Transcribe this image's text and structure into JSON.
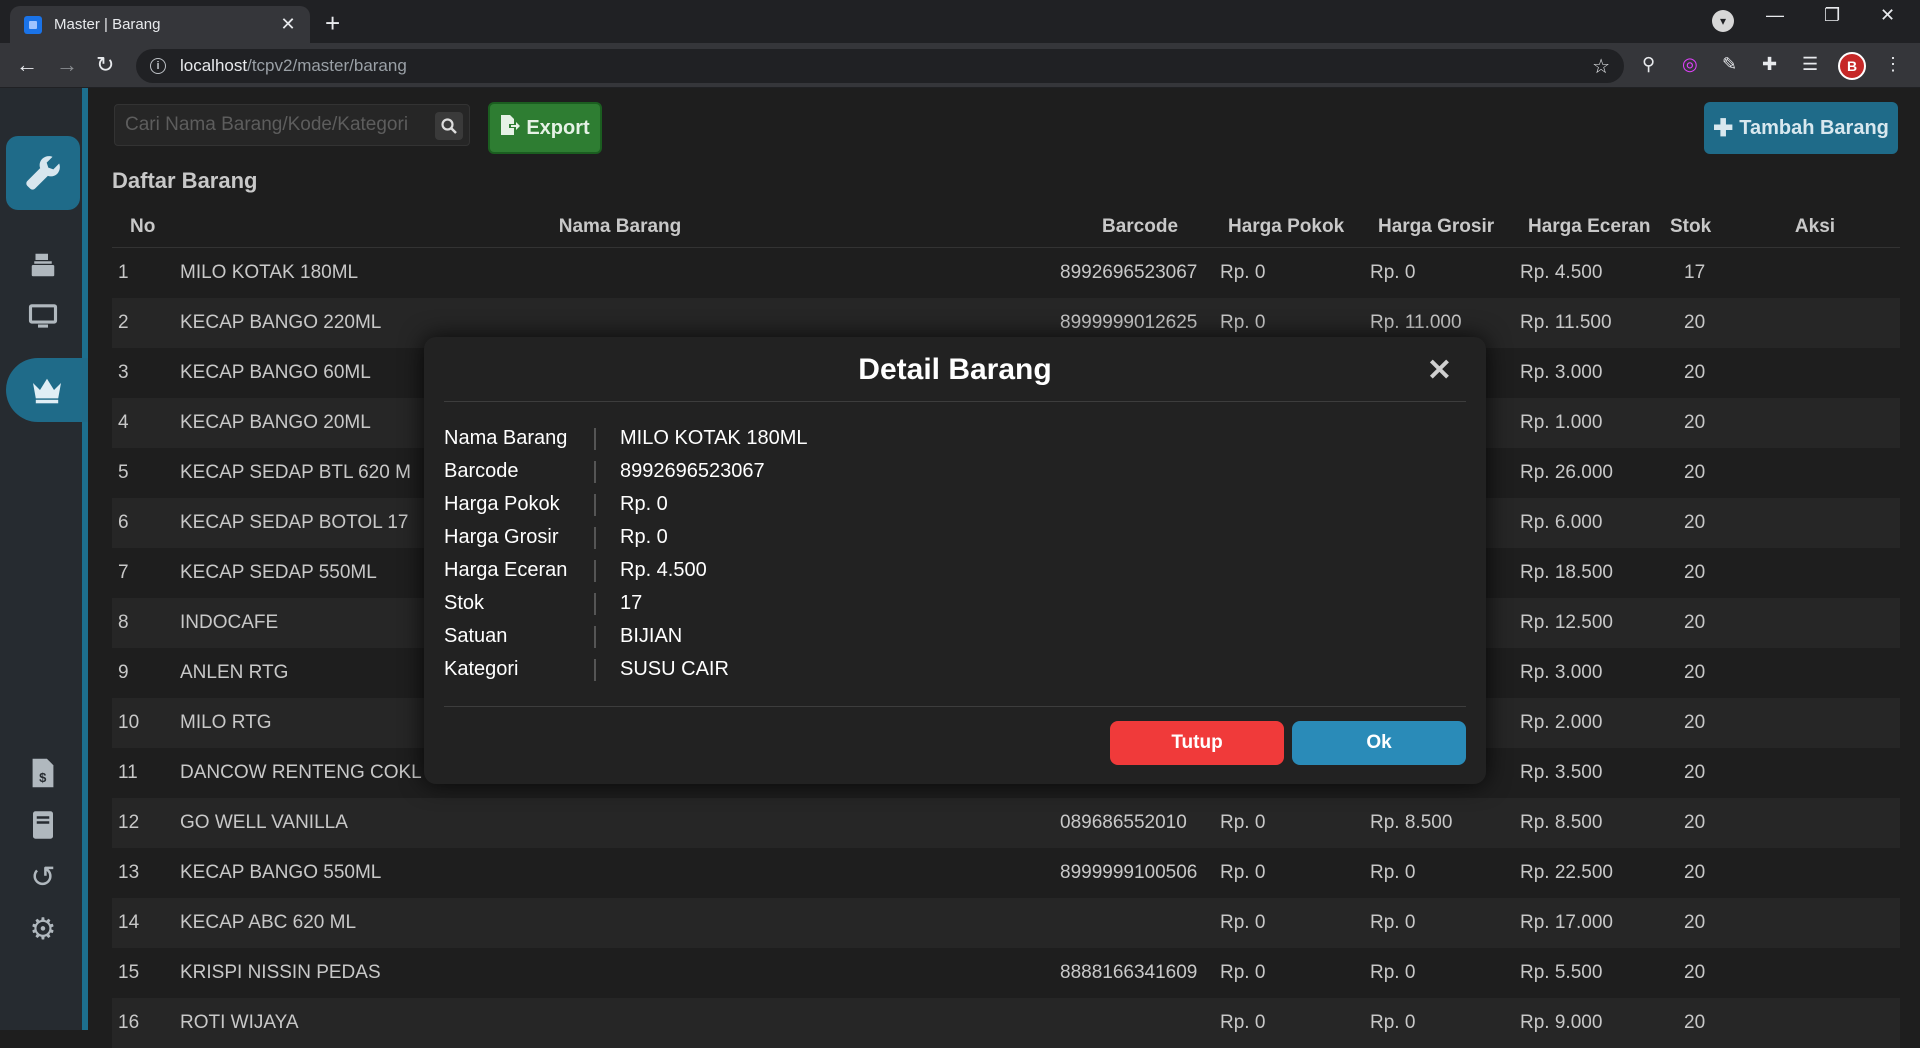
{
  "browser": {
    "tab_title": "Master | Barang",
    "tab_close": "✕",
    "new_tab": "+",
    "url_host": "localhost",
    "url_path": "/tcpv2/master/barang",
    "win_min": "—",
    "win_restore": "❐",
    "win_close": "✕",
    "avatar_letter": "B"
  },
  "toolbar": {
    "search_placeholder": "Cari Nama Barang/Kode/Kategori",
    "export_label": "Export",
    "add_label": "Tambah Barang"
  },
  "page": {
    "list_title": "Daftar Barang"
  },
  "table": {
    "headers": {
      "no": "No",
      "name": "Nama Barang",
      "barcode": "Barcode",
      "harga_pokok": "Harga Pokok",
      "harga_grosir": "Harga Grosir",
      "harga_eceran": "Harga Eceran",
      "stok": "Stok",
      "aksi": "Aksi"
    },
    "rows": [
      {
        "no": "1",
        "name": "MILO KOTAK 180ML",
        "barcode": "8992696523067",
        "pokok": "Rp. 0",
        "grosir": "Rp. 0",
        "eceran": "Rp. 4.500",
        "stok": "17"
      },
      {
        "no": "2",
        "name": "KECAP BANGO 220ML",
        "barcode": "8999999012625",
        "pokok": "Rp. 0",
        "grosir": "Rp. 11.000",
        "eceran": "Rp. 11.500",
        "stok": "20"
      },
      {
        "no": "3",
        "name": "KECAP BANGO 60ML",
        "barcode": "",
        "pokok": "",
        "grosir": "",
        "eceran": "Rp. 3.000",
        "stok": "20"
      },
      {
        "no": "4",
        "name": "KECAP BANGO 20ML",
        "barcode": "",
        "pokok": "",
        "grosir": "",
        "eceran": "Rp. 1.000",
        "stok": "20"
      },
      {
        "no": "5",
        "name": "KECAP SEDAP BTL 620 M",
        "barcode": "",
        "pokok": "",
        "grosir": "",
        "eceran": "Rp. 26.000",
        "stok": "20"
      },
      {
        "no": "6",
        "name": "KECAP SEDAP BOTOL 17",
        "barcode": "",
        "pokok": "",
        "grosir": "",
        "eceran": "Rp. 6.000",
        "stok": "20"
      },
      {
        "no": "7",
        "name": "KECAP SEDAP 550ML",
        "barcode": "",
        "pokok": "",
        "grosir": "",
        "eceran": "Rp. 18.500",
        "stok": "20"
      },
      {
        "no": "8",
        "name": "INDOCAFE",
        "barcode": "",
        "pokok": "",
        "grosir": "",
        "eceran": "Rp. 12.500",
        "stok": "20"
      },
      {
        "no": "9",
        "name": "ANLEN RTG",
        "barcode": "",
        "pokok": "",
        "grosir": "",
        "eceran": "Rp. 3.000",
        "stok": "20"
      },
      {
        "no": "10",
        "name": "MILO RTG",
        "barcode": "",
        "pokok": "",
        "grosir": "",
        "eceran": "Rp. 2.000",
        "stok": "20"
      },
      {
        "no": "11",
        "name": "DANCOW RENTENG COKL",
        "barcode": "",
        "pokok": "",
        "grosir": "",
        "eceran": "Rp. 3.500",
        "stok": "20"
      },
      {
        "no": "12",
        "name": "GO WELL VANILLA",
        "barcode": "089686552010",
        "pokok": "Rp. 0",
        "grosir": "Rp. 8.500",
        "eceran": "Rp. 8.500",
        "stok": "20"
      },
      {
        "no": "13",
        "name": "KECAP BANGO 550ML",
        "barcode": "8999999100506",
        "pokok": "Rp. 0",
        "grosir": "Rp. 0",
        "eceran": "Rp. 22.500",
        "stok": "20"
      },
      {
        "no": "14",
        "name": "KECAP ABC 620 ML",
        "barcode": "",
        "pokok": "Rp. 0",
        "grosir": "Rp. 0",
        "eceran": "Rp. 17.000",
        "stok": "20"
      },
      {
        "no": "15",
        "name": "KRISPI NISSIN PEDAS",
        "barcode": "8888166341609",
        "pokok": "Rp. 0",
        "grosir": "Rp. 0",
        "eceran": "Rp. 5.500",
        "stok": "20"
      },
      {
        "no": "16",
        "name": "ROTI WIJAYA",
        "barcode": "",
        "pokok": "Rp. 0",
        "grosir": "Rp. 0",
        "eceran": "Rp. 9.000",
        "stok": "20"
      }
    ]
  },
  "modal": {
    "title": "Detail Barang",
    "close": "✕",
    "fields": [
      {
        "label": "Nama Barang",
        "value": "MILO KOTAK 180ML"
      },
      {
        "label": "Barcode",
        "value": "8992696523067"
      },
      {
        "label": "Harga Pokok",
        "value": "Rp. 0"
      },
      {
        "label": "Harga Grosir",
        "value": "Rp. 0"
      },
      {
        "label": "Harga Eceran",
        "value": "Rp. 4.500"
      },
      {
        "label": "Stok",
        "value": "17"
      },
      {
        "label": "Satuan",
        "value": "BIJIAN"
      },
      {
        "label": "Kategori",
        "value": "SUSU CAIR"
      }
    ],
    "btn_tutup": "Tutup",
    "btn_ok": "Ok"
  },
  "colors": {
    "accent": "#1f6b89",
    "export_green": "#2e7d32",
    "tutup_red": "#f03a3a",
    "ok_blue": "#2a8bb8"
  },
  "icons": {
    "sidebar": [
      "wrench-icon",
      "cash-register-icon",
      "monitor-icon",
      "crown-icon",
      "invoice-icon",
      "book-icon",
      "history-icon",
      "gear-icon"
    ]
  }
}
